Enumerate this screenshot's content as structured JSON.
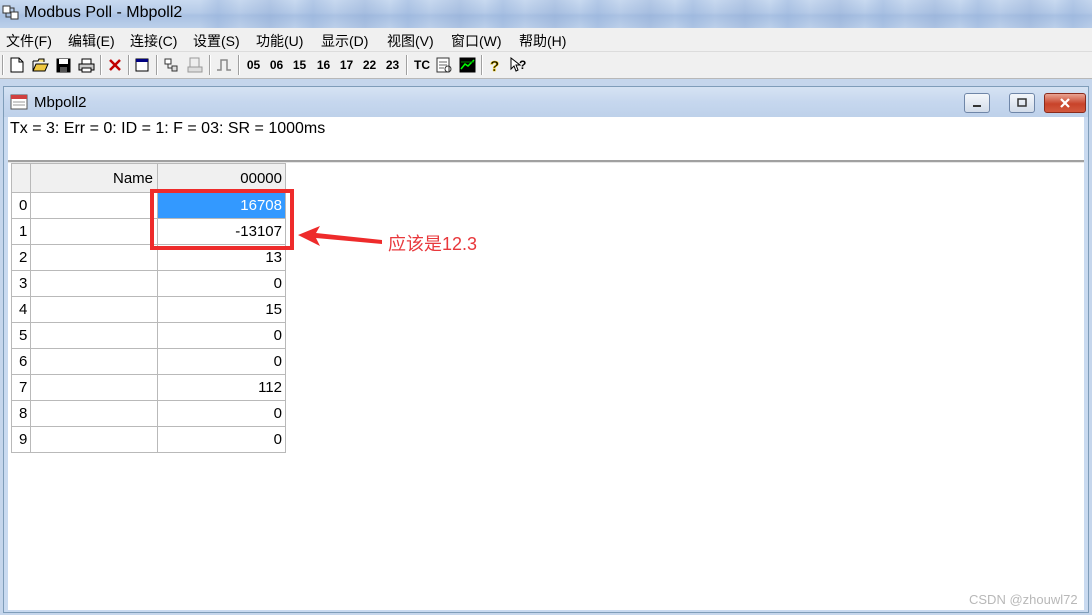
{
  "app": {
    "title": "Modbus Poll - Mbpoll2"
  },
  "menu": [
    "文件(F)",
    "编辑(E)",
    "连接(C)",
    "设置(S)",
    "功能(U)",
    "显示(D)",
    "视图(V)",
    "窗口(W)",
    "帮助(H)"
  ],
  "toolbar": {
    "icons": [
      "new-icon",
      "open-icon",
      "save-icon",
      "print-icon",
      "delete-icon",
      "window-icon",
      "connect-icon",
      "disconnect-icon",
      "pulse-icon",
      "communication-icon",
      "chart-icon",
      "help-icon",
      "context-help-icon"
    ],
    "function_codes": [
      "05",
      "06",
      "15",
      "16",
      "17",
      "22",
      "23"
    ],
    "tc_label": "TC"
  },
  "child": {
    "title": "Mbpoll2",
    "status": "Tx = 3: Err = 0: ID = 1: F = 03: SR = 1000ms"
  },
  "grid": {
    "name_header": "Name",
    "address_header": "00000",
    "rows": [
      {
        "index": "0",
        "name": "",
        "value": "16708",
        "selected": true
      },
      {
        "index": "1",
        "name": "",
        "value": "-13107",
        "selected": false
      },
      {
        "index": "2",
        "name": "",
        "value": "13",
        "selected": false
      },
      {
        "index": "3",
        "name": "",
        "value": "0",
        "selected": false
      },
      {
        "index": "4",
        "name": "",
        "value": "15",
        "selected": false
      },
      {
        "index": "5",
        "name": "",
        "value": "0",
        "selected": false
      },
      {
        "index": "6",
        "name": "",
        "value": "0",
        "selected": false
      },
      {
        "index": "7",
        "name": "",
        "value": "112",
        "selected": false
      },
      {
        "index": "8",
        "name": "",
        "value": "0",
        "selected": false
      },
      {
        "index": "9",
        "name": "",
        "value": "0",
        "selected": false
      }
    ]
  },
  "annotation": {
    "text": "应该是12.3",
    "color": "#e8383c"
  },
  "watermark": "CSDN @zhouwl72"
}
